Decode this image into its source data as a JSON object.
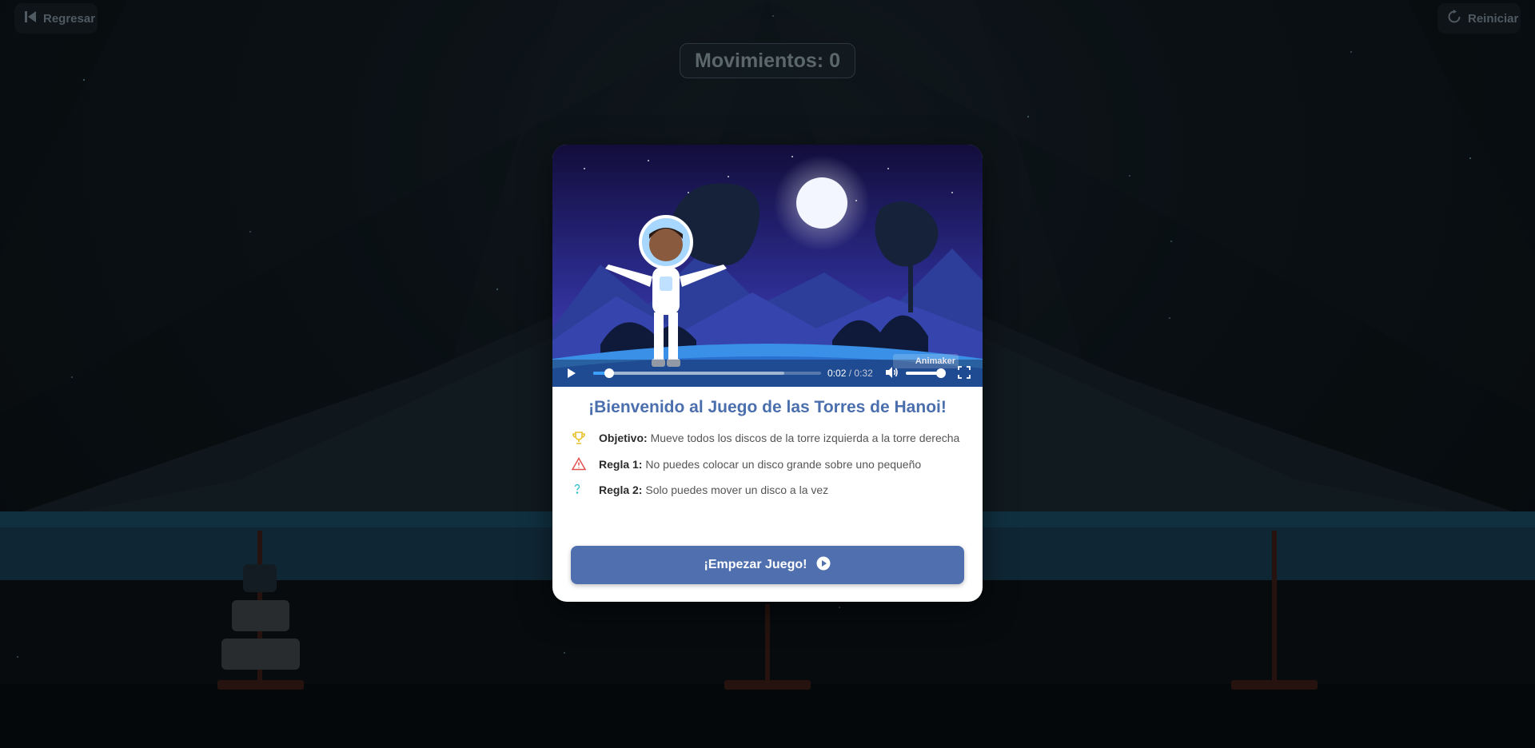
{
  "header": {
    "back_label": "Regresar",
    "restart_label": "Reiniciar",
    "moves_label": "Movimientos:",
    "moves_count": "0"
  },
  "video": {
    "current_time": "0:02",
    "separator": "/",
    "duration": "0:32",
    "progress_fraction": 0.07,
    "buffer_fraction": 0.84,
    "volume_fraction": 1.0,
    "watermark": "Animaker"
  },
  "modal": {
    "title": "¡Bienvenido al Juego de las Torres de Hanoi!",
    "rules": [
      {
        "label": "Objetivo:",
        "text": "Mueve todos los discos de la torre izquierda a la torre derecha",
        "icon": "trophy-icon",
        "color": "#e8c22c"
      },
      {
        "label": "Regla 1:",
        "text": "No puedes colocar un disco grande sobre uno pequeño",
        "icon": "warning-icon",
        "color": "#e05252"
      },
      {
        "label": "Regla 2:",
        "text": "Solo puedes mover un disco a la vez",
        "icon": "question-icon",
        "color": "#34c0c9"
      }
    ],
    "start_label": "¡Empezar Juego!"
  },
  "colors": {
    "accent": "#4f6faf",
    "title": "#4b6fad",
    "progress": "#3ba0ff"
  }
}
